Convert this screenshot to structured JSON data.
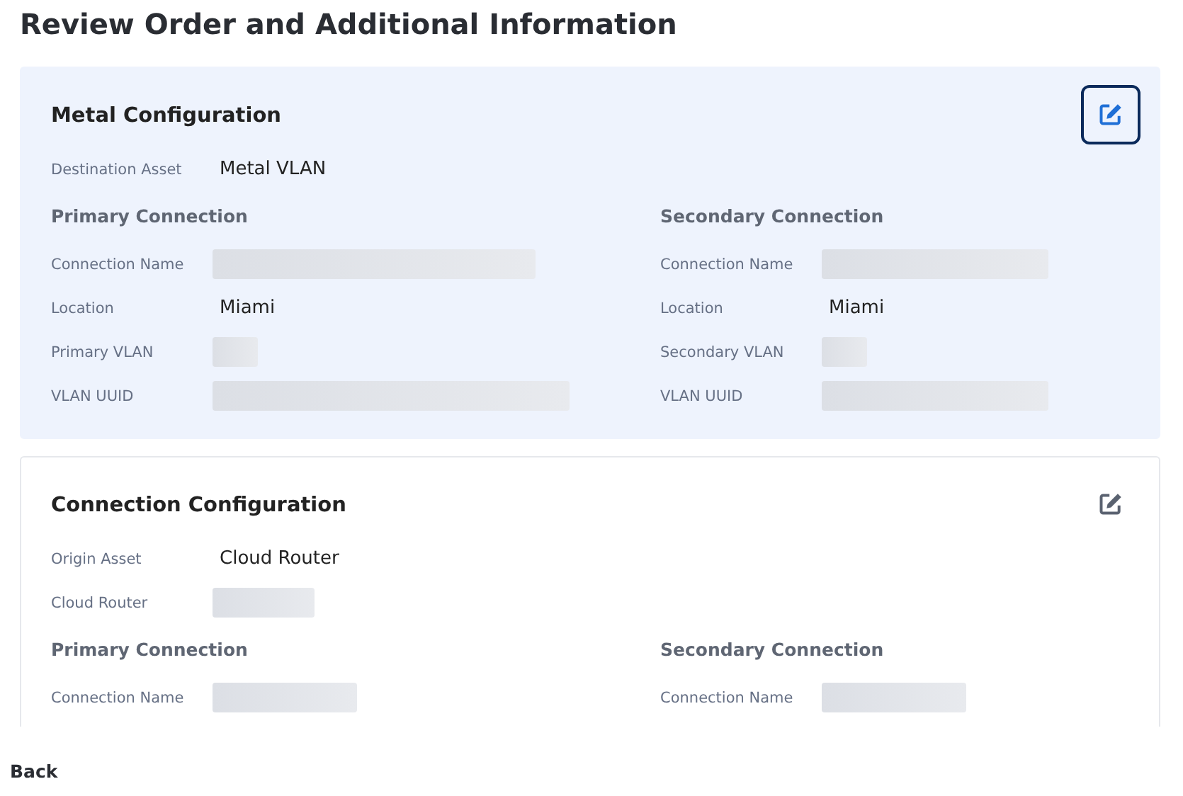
{
  "page": {
    "title": "Review Order and Additional Information"
  },
  "sections": [
    {
      "title": "Metal Configuration",
      "focused": true,
      "top_fields": [
        {
          "label": "Destination Asset",
          "kind": "text",
          "value": "Metal VLAN"
        }
      ],
      "columns": [
        {
          "heading": "Primary Connection",
          "fields": [
            {
              "label": "Connection Name",
              "kind": "redacted-long"
            },
            {
              "label": "Location",
              "kind": "text",
              "value": "Miami"
            },
            {
              "label": "Primary VLAN",
              "kind": "redacted-short"
            },
            {
              "label": "VLAN UUID",
              "kind": "redacted-xlong"
            }
          ]
        },
        {
          "heading": "Secondary Connection",
          "fields": [
            {
              "label": "Connection Name",
              "kind": "redacted-medium"
            },
            {
              "label": "Location",
              "kind": "text",
              "value": "Miami"
            },
            {
              "label": "Secondary VLAN",
              "kind": "redacted-short"
            },
            {
              "label": "VLAN UUID",
              "kind": "redacted-medium"
            }
          ]
        }
      ]
    },
    {
      "title": "Connection Configuration",
      "focused": false,
      "top_fields": [
        {
          "label": "Origin Asset",
          "kind": "text",
          "value": "Cloud Router"
        },
        {
          "label": "Cloud Router",
          "kind": "redacted-small"
        }
      ],
      "columns": [
        {
          "heading": "Primary Connection",
          "fields": [
            {
              "label": "Connection Name",
              "kind": "redacted-small-medium"
            }
          ]
        },
        {
          "heading": "Secondary Connection",
          "fields": [
            {
              "label": "Connection Name",
              "kind": "redacted-small-medium"
            }
          ]
        }
      ]
    }
  ],
  "back_button": "Back"
}
